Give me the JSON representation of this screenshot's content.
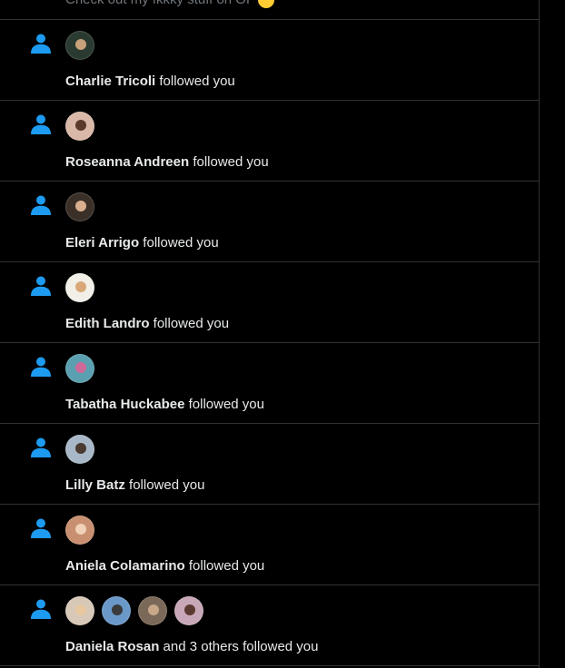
{
  "top_snippet": {
    "text": "Check out my fkkky stuff on OF"
  },
  "notifications": [
    {
      "name": "Charlie Tricoli",
      "suffix": " followed you",
      "avatars": [
        {
          "bg": "#2a3a30",
          "head": "#c8a07a"
        }
      ]
    },
    {
      "name": "Roseanna Andreen",
      "suffix": " followed you",
      "avatars": [
        {
          "bg": "#d9b8a8",
          "head": "#5a3a2a"
        }
      ]
    },
    {
      "name": "Eleri Arrigo",
      "suffix": " followed you",
      "avatars": [
        {
          "bg": "#3a3028",
          "head": "#d8b090"
        }
      ]
    },
    {
      "name": "Edith Landro",
      "suffix": " followed you",
      "avatars": [
        {
          "bg": "#f2efe8",
          "head": "#d8a878"
        }
      ]
    },
    {
      "name": "Tabatha Huckabee",
      "suffix": " followed you",
      "avatars": [
        {
          "bg": "#5aa0b0",
          "head": "#d06a9a"
        }
      ]
    },
    {
      "name": "Lilly Batz",
      "suffix": " followed you",
      "avatars": [
        {
          "bg": "#a8b8c8",
          "head": "#4a3a30"
        }
      ]
    },
    {
      "name": "Aniela Colamarino",
      "suffix": " followed you",
      "avatars": [
        {
          "bg": "#c89070",
          "head": "#f0d0b8"
        }
      ]
    },
    {
      "name": "Daniela Rosan",
      "suffix": " and 3 others followed you",
      "avatars": [
        {
          "bg": "#d8c8b8",
          "head": "#e8c8a0"
        },
        {
          "bg": "#6a98c8",
          "head": "#3a3a3a"
        },
        {
          "bg": "#7a6858",
          "head": "#c8a888"
        },
        {
          "bg": "#c8a8b8",
          "head": "#5a3a30"
        }
      ]
    }
  ],
  "colors": {
    "accent": "#1d9bf0",
    "divider": "#2f3336",
    "text": "#e7e9ea",
    "muted": "#71767b"
  },
  "icons": {
    "notification_type": "person-icon"
  }
}
